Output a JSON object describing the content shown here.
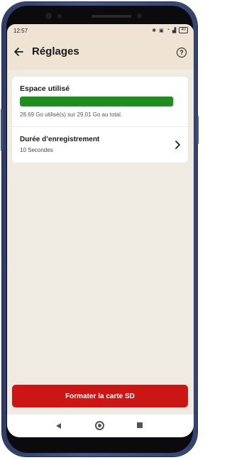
{
  "status_bar": {
    "time": "12:57",
    "icons": [
      "bluetooth-icon",
      "alarm-icon",
      "wifi-icon",
      "signal-icon"
    ],
    "battery_level": "40"
  },
  "header": {
    "title": "Réglages",
    "back_icon": "back-arrow-icon",
    "help_label": "?"
  },
  "storage": {
    "label": "Espace utilisé",
    "usage_text": "28.69 Go utilisé(s) sur 29.01 Go au total.",
    "used_gb": 28.69,
    "total_gb": 29.01,
    "bar_color": "#1e8e1e"
  },
  "recording": {
    "label": "Durée d’enregistrement",
    "value": "10 Secondes"
  },
  "format_button": {
    "label": "Formater la carte SD",
    "color": "#cc1515"
  },
  "nav": [
    "nav-back-icon",
    "nav-home-icon",
    "nav-recent-icon"
  ]
}
